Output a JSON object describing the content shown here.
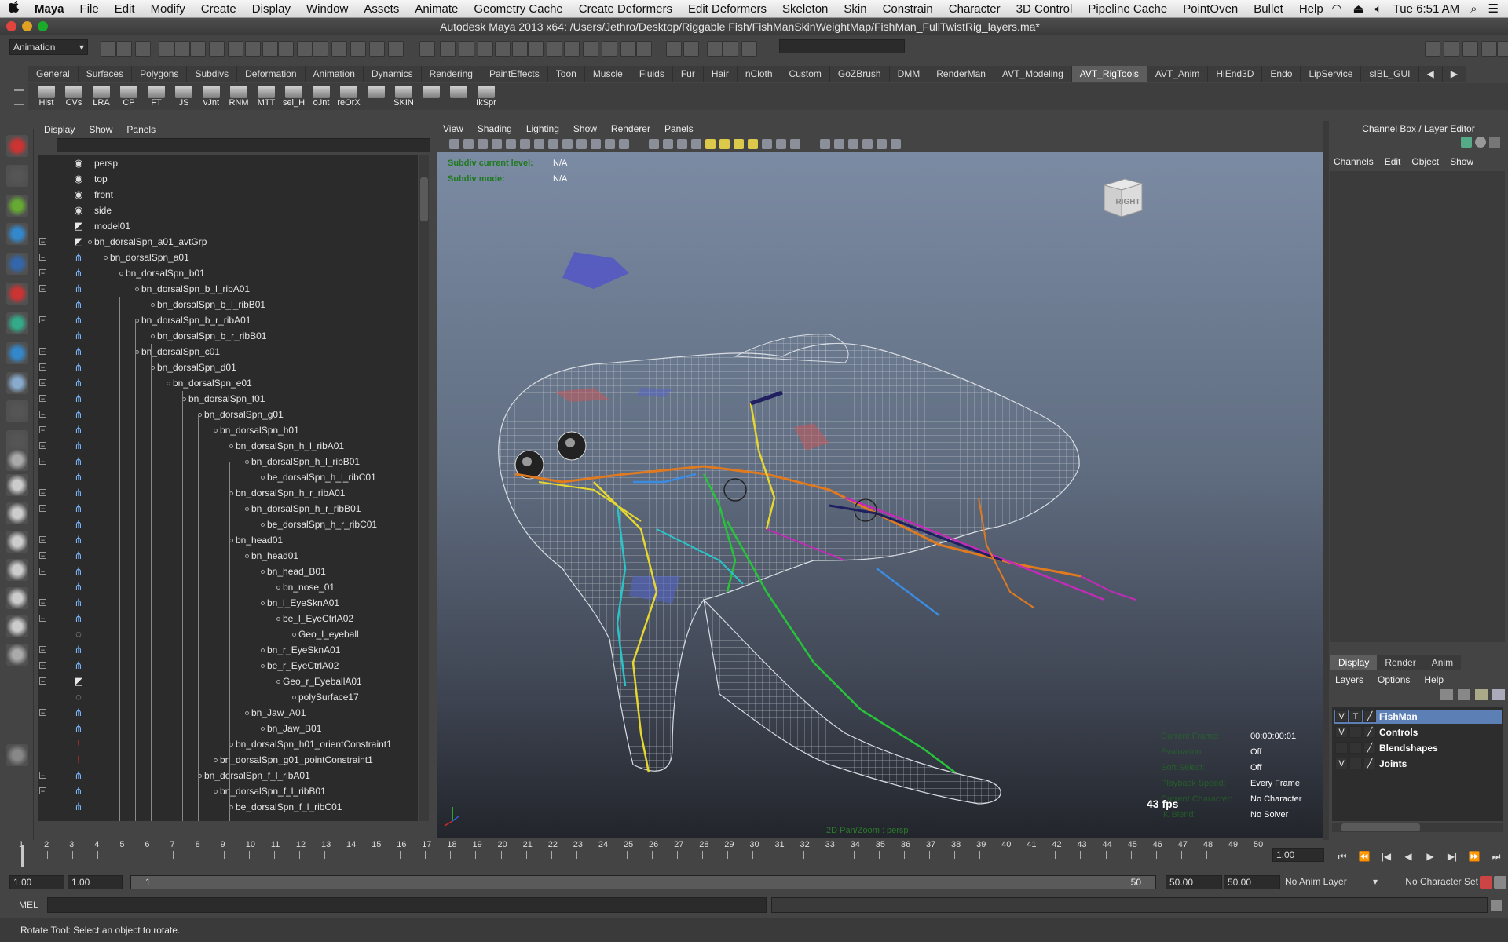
{
  "menubar": {
    "apple": "",
    "items": [
      "Maya",
      "File",
      "Edit",
      "Modify",
      "Create",
      "Display",
      "Window",
      "Assets",
      "Animate",
      "Geometry Cache",
      "Create Deformers",
      "Edit Deformers",
      "Skeleton",
      "Skin",
      "Constrain",
      "Character",
      "3D Control",
      "Pipeline Cache",
      "PointOven",
      "Bullet",
      "Help"
    ],
    "clock": "Tue 6:51 AM"
  },
  "window": {
    "title": "Autodesk Maya 2013 x64: /Users/Jethro/Desktop/Riggable Fish/FishManSkinWeightMap/FishMan_FullTwistRig_layers.ma*"
  },
  "statusline": {
    "menuset": "Animation"
  },
  "shelf": {
    "tabs": [
      "General",
      "Surfaces",
      "Polygons",
      "Subdivs",
      "Deformation",
      "Animation",
      "Dynamics",
      "Rendering",
      "PaintEffects",
      "Toon",
      "Muscle",
      "Fluids",
      "Fur",
      "Hair",
      "nCloth",
      "Custom",
      "GoZBrush",
      "DMM",
      "RenderMan",
      "AVT_Modeling",
      "AVT_RigTools",
      "AVT_Anim",
      "HiEnd3D",
      "Endo",
      "LipService",
      "sIBL_GUI"
    ],
    "active_tab": "AVT_RigTools",
    "buttons": [
      "Hist",
      "CVs",
      "LRA",
      "CP",
      "FT",
      "JS",
      "vJnt",
      "RNM",
      "MTT",
      "sel_H",
      "oJnt",
      "reOrX",
      "",
      "SKIN",
      "",
      "",
      "IkSpr"
    ]
  },
  "outliner": {
    "menu": [
      "Display",
      "Show",
      "Panels"
    ],
    "rows": [
      {
        "label": "persp",
        "indent": 0,
        "icon": "camera",
        "exp": ""
      },
      {
        "label": "top",
        "indent": 0,
        "icon": "camera",
        "exp": ""
      },
      {
        "label": "front",
        "indent": 0,
        "icon": "camera",
        "exp": ""
      },
      {
        "label": "side",
        "indent": 0,
        "icon": "camera",
        "exp": ""
      },
      {
        "label": "model01",
        "indent": 0,
        "icon": "mesh",
        "exp": ""
      },
      {
        "label": "bn_dorsalSpn_a01_avtGrp",
        "indent": 0,
        "icon": "mesh",
        "exp": "-"
      },
      {
        "label": "bn_dorsalSpn_a01",
        "indent": 1,
        "icon": "joint",
        "exp": "-"
      },
      {
        "label": "bn_dorsalSpn_b01",
        "indent": 2,
        "icon": "joint",
        "exp": "-"
      },
      {
        "label": "bn_dorsalSpn_b_l_ribA01",
        "indent": 3,
        "icon": "joint",
        "exp": "-"
      },
      {
        "label": "bn_dorsalSpn_b_l_ribB01",
        "indent": 4,
        "icon": "joint",
        "exp": ""
      },
      {
        "label": "bn_dorsalSpn_b_r_ribA01",
        "indent": 3,
        "icon": "joint",
        "exp": "-"
      },
      {
        "label": "bn_dorsalSpn_b_r_ribB01",
        "indent": 4,
        "icon": "joint",
        "exp": ""
      },
      {
        "label": "bn_dorsalSpn_c01",
        "indent": 3,
        "icon": "joint",
        "exp": "-"
      },
      {
        "label": "bn_dorsalSpn_d01",
        "indent": 4,
        "icon": "joint",
        "exp": "-"
      },
      {
        "label": "bn_dorsalSpn_e01",
        "indent": 5,
        "icon": "joint",
        "exp": "-"
      },
      {
        "label": "bn_dorsalSpn_f01",
        "indent": 6,
        "icon": "joint",
        "exp": "-"
      },
      {
        "label": "bn_dorsalSpn_g01",
        "indent": 7,
        "icon": "joint",
        "exp": "-"
      },
      {
        "label": "bn_dorsalSpn_h01",
        "indent": 8,
        "icon": "joint",
        "exp": "-"
      },
      {
        "label": "bn_dorsalSpn_h_l_ribA01",
        "indent": 9,
        "icon": "joint",
        "exp": "-"
      },
      {
        "label": "bn_dorsalSpn_h_l_ribB01",
        "indent": 10,
        "icon": "joint",
        "exp": "-"
      },
      {
        "label": "be_dorsalSpn_h_l_ribC01",
        "indent": 11,
        "icon": "joint",
        "exp": ""
      },
      {
        "label": "bn_dorsalSpn_h_r_ribA01",
        "indent": 9,
        "icon": "joint",
        "exp": "-"
      },
      {
        "label": "bn_dorsalSpn_h_r_ribB01",
        "indent": 10,
        "icon": "joint",
        "exp": "-"
      },
      {
        "label": "be_dorsalSpn_h_r_ribC01",
        "indent": 11,
        "icon": "joint",
        "exp": ""
      },
      {
        "label": "bn_head01",
        "indent": 9,
        "icon": "joint",
        "exp": "-"
      },
      {
        "label": "bn_head01",
        "indent": 10,
        "icon": "joint",
        "exp": "-"
      },
      {
        "label": "bn_head_B01",
        "indent": 11,
        "icon": "joint",
        "exp": "-"
      },
      {
        "label": "bn_nose_01",
        "indent": 12,
        "icon": "joint",
        "exp": ""
      },
      {
        "label": "bn_l_EyeSknA01",
        "indent": 11,
        "icon": "joint",
        "exp": "-"
      },
      {
        "label": "be_l_EyeCtrlA02",
        "indent": 12,
        "icon": "joint",
        "exp": "-"
      },
      {
        "label": "Geo_l_eyeball",
        "indent": 13,
        "icon": "mesh-small",
        "exp": ""
      },
      {
        "label": "bn_r_EyeSknA01",
        "indent": 11,
        "icon": "joint",
        "exp": "-"
      },
      {
        "label": "be_r_EyeCtrlA02",
        "indent": 11,
        "icon": "joint",
        "exp": "-"
      },
      {
        "label": "Geo_r_EyeballA01",
        "indent": 12,
        "icon": "mesh",
        "exp": "-"
      },
      {
        "label": "polySurface17",
        "indent": 13,
        "icon": "mesh-small",
        "exp": ""
      },
      {
        "label": "bn_Jaw_A01",
        "indent": 10,
        "icon": "joint",
        "exp": "-"
      },
      {
        "label": "bn_Jaw_B01",
        "indent": 11,
        "icon": "joint",
        "exp": ""
      },
      {
        "label": "bn_dorsalSpn_h01_orientConstraint1",
        "indent": 9,
        "icon": "constraint",
        "exp": ""
      },
      {
        "label": "bn_dorsalSpn_g01_pointConstraint1",
        "indent": 8,
        "icon": "constraint",
        "exp": ""
      },
      {
        "label": "bn_dorsalSpn_f_l_ribA01",
        "indent": 7,
        "icon": "joint",
        "exp": "-"
      },
      {
        "label": "bn_dorsalSpn_f_l_ribB01",
        "indent": 8,
        "icon": "joint",
        "exp": "-"
      },
      {
        "label": "be_dorsalSpn_f_l_ribC01",
        "indent": 9,
        "icon": "joint",
        "exp": ""
      }
    ]
  },
  "viewport": {
    "menu": [
      "View",
      "Shading",
      "Lighting",
      "Show",
      "Renderer",
      "Panels"
    ],
    "hud_top": [
      {
        "label": "Subdiv current level:",
        "value": "N/A"
      },
      {
        "label": "Subdiv mode:",
        "value": "N/A"
      }
    ],
    "viewcube_label": "RIGHT",
    "hud_bottom": [
      {
        "label": "Current Frame:",
        "value": "00:00:00:01"
      },
      {
        "label": "Evaluation:",
        "value": "Off"
      },
      {
        "label": "Soft Select:",
        "value": "Off"
      },
      {
        "label": "Playback Speed:",
        "value": "Every Frame"
      },
      {
        "label": "Current Character:",
        "value": "No Character"
      },
      {
        "label": "IK Blend:",
        "value": "No Solver"
      }
    ],
    "fps": "43 fps",
    "camera_label": "2D Pan/Zoom : persp"
  },
  "channelbox": {
    "title": "Channel Box / Layer Editor",
    "menu": [
      "Channels",
      "Edit",
      "Object",
      "Show"
    ]
  },
  "layer_editor": {
    "tabs": [
      "Display",
      "Render",
      "Anim"
    ],
    "active_tab": "Display",
    "menu": [
      "Layers",
      "Options",
      "Help"
    ],
    "layers": [
      {
        "v": "V",
        "t": "T",
        "name": "FishMan",
        "selected": true
      },
      {
        "v": "V",
        "t": "",
        "name": "Controls",
        "selected": false
      },
      {
        "v": "",
        "t": "",
        "name": "Blendshapes",
        "selected": false
      },
      {
        "v": "V",
        "t": "",
        "name": "Joints",
        "selected": false
      }
    ]
  },
  "timeslider": {
    "ticks": [
      "1",
      "2",
      "3",
      "4",
      "5",
      "6",
      "7",
      "8",
      "9",
      "10",
      "11",
      "12",
      "13",
      "14",
      "15",
      "16",
      "17",
      "18",
      "19",
      "20",
      "21",
      "22",
      "23",
      "24",
      "25",
      "26",
      "27",
      "28",
      "29",
      "30",
      "31",
      "32",
      "33",
      "34",
      "35",
      "36",
      "37",
      "38",
      "39",
      "40",
      "41",
      "42",
      "43",
      "44",
      "45",
      "46",
      "47",
      "48",
      "49",
      "50"
    ],
    "current_frame": "1.00"
  },
  "rangeslider": {
    "start": "1.00",
    "playback_start": "1.00",
    "range_left": "1",
    "range_right": "50",
    "playback_end": "50.00",
    "end": "50.00",
    "anim_layer": "No Anim Layer",
    "character_set": "No Character Set"
  },
  "mel": {
    "label": "MEL"
  },
  "helpline": {
    "text": "Rotate Tool: Select an object to rotate."
  },
  "colors": {
    "accent": "#5c7fb6",
    "viewport_top": "#7b8ba3",
    "viewport_bottom": "#22252b"
  }
}
